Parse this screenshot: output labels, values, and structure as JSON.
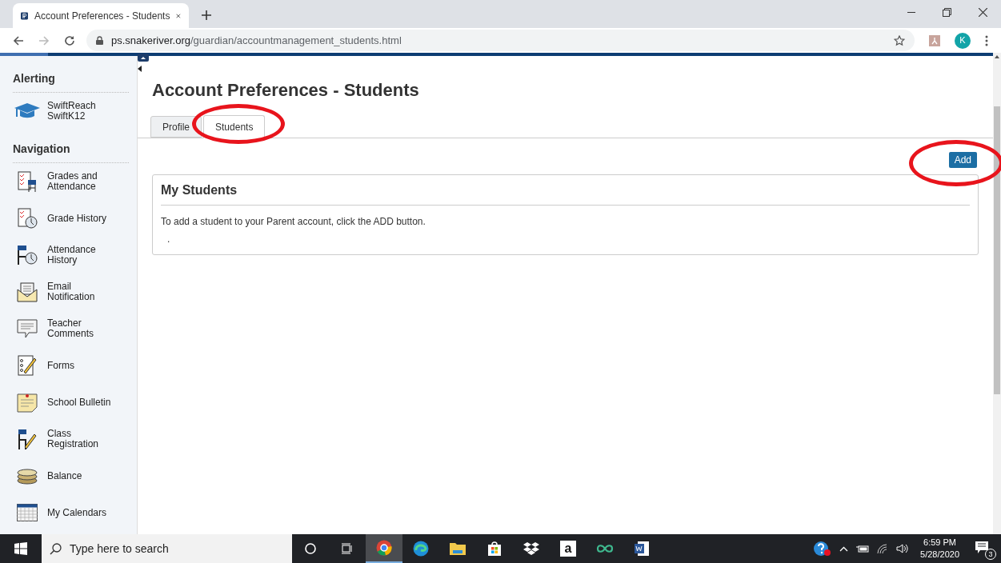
{
  "browser": {
    "tab_title": "Account Preferences - Students",
    "url_host": "ps.snakeriver.org",
    "url_path": "/guardian/accountmanagement_students.html",
    "profile_initial": "K"
  },
  "sidebar": {
    "sections": [
      {
        "heading": "Alerting",
        "items": [
          {
            "label": "SwiftReach SwiftK12"
          }
        ]
      },
      {
        "heading": "Navigation",
        "items": [
          {
            "label": "Grades and Attendance"
          },
          {
            "label": "Grade History"
          },
          {
            "label": "Attendance History"
          },
          {
            "label": "Email Notification"
          },
          {
            "label": "Teacher Comments"
          },
          {
            "label": "Forms"
          },
          {
            "label": "School Bulletin"
          },
          {
            "label": "Class Registration"
          },
          {
            "label": "Balance"
          },
          {
            "label": "My Calendars"
          }
        ]
      }
    ]
  },
  "page": {
    "title": "Account Preferences - Students",
    "tabs": [
      {
        "label": "Profile",
        "selected": false,
        "circled": false
      },
      {
        "label": "Students",
        "selected": true,
        "circled": true
      }
    ],
    "add_button": {
      "label": "Add",
      "circled": true
    },
    "panel": {
      "title": "My Students",
      "text": "To add a student to your Parent account, click the ADD button.",
      "note": "."
    }
  },
  "taskbar": {
    "search_placeholder": "Type here to search",
    "pinned_letter": "a",
    "time": "6:59 PM",
    "date": "5/28/2020",
    "notifications": "3"
  }
}
